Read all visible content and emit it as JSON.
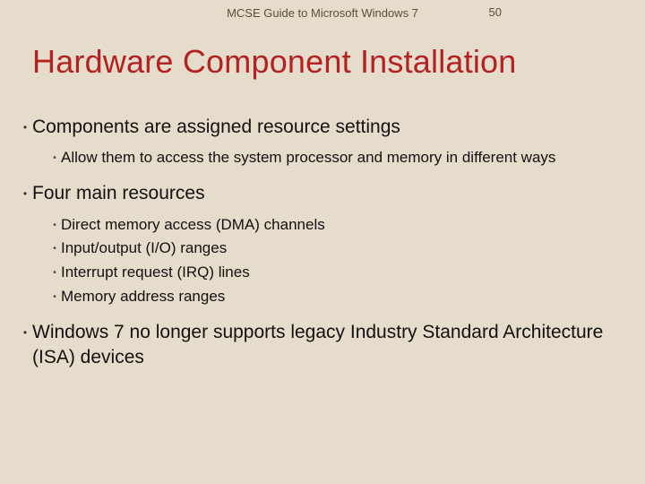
{
  "header": {
    "book_title": "MCSE Guide to Microsoft Windows 7",
    "page_number": "50"
  },
  "title": "Hardware Component Installation",
  "bullets": [
    {
      "text": "Components are assigned resource settings",
      "sub": [
        {
          "text": "Allow them to access the system processor and memory in different ways"
        }
      ]
    },
    {
      "text": "Four main resources",
      "sub": [
        {
          "text": "Direct memory access (DMA) channels"
        },
        {
          "text": "Input/output (I/O) ranges"
        },
        {
          "text": "Interrupt request (IRQ) lines"
        },
        {
          "text": "Memory address ranges"
        }
      ]
    },
    {
      "text": "Windows 7 no longer supports legacy Industry Standard Architecture (ISA) devices",
      "sub": []
    }
  ]
}
